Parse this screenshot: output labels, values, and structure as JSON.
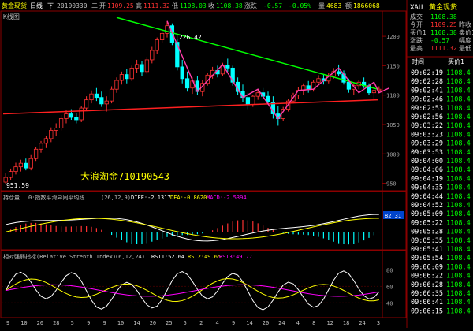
{
  "header": {
    "name": "黄金现货",
    "period": "日线",
    "dir": "下",
    "date": "20100330",
    "weekday": "二",
    "open_label": "开",
    "open": "1109.25",
    "high_label": "高",
    "high": "1111.32",
    "low_label": "低",
    "low": "1108.03",
    "close_label": "收",
    "close": "1108.38",
    "change_label": "涨跌",
    "change": "-0.57",
    "change_pct": "-0.05%",
    "volume_label": "量",
    "volume": "4683",
    "amount_label": "额",
    "amount": "1866068"
  },
  "main_chart": {
    "title": "K线图",
    "peak_label": "1226.42",
    "low_label": "951.59",
    "watermark": "大浪淘金710190543",
    "yticks": [
      "1200",
      "1150",
      "1100",
      "1050",
      "1000",
      "950"
    ]
  },
  "chart_data": [
    {
      "type": "candlestick",
      "title": "K线图",
      "ylim": [
        940,
        1235
      ],
      "annotations": [
        {
          "text": "1226.42",
          "kind": "high"
        },
        {
          "text": "951.59",
          "kind": "low"
        }
      ],
      "trendlines": [
        {
          "color": "#00ff00",
          "from": [
            0.3,
            1232
          ],
          "to": [
            0.99,
            1110
          ]
        },
        {
          "color": "#ff2020",
          "from": [
            0.0,
            1068
          ],
          "to": [
            0.99,
            1092
          ]
        }
      ],
      "candles": [
        [
          952,
          968,
          948,
          960
        ],
        [
          960,
          975,
          955,
          970
        ],
        [
          970,
          985,
          965,
          978
        ],
        [
          978,
          990,
          970,
          984
        ],
        [
          984,
          992,
          972,
          976
        ],
        [
          976,
          998,
          972,
          992
        ],
        [
          992,
          1012,
          988,
          1008
        ],
        [
          1008,
          1022,
          1002,
          1018
        ],
        [
          1018,
          1030,
          1010,
          1026
        ],
        [
          1026,
          1045,
          1020,
          1040
        ],
        [
          1040,
          1052,
          1030,
          1044
        ],
        [
          1044,
          1066,
          1040,
          1060
        ],
        [
          1060,
          1074,
          1052,
          1068
        ],
        [
          1068,
          1076,
          1058,
          1062
        ],
        [
          1062,
          1070,
          1052,
          1058
        ],
        [
          1058,
          1082,
          1054,
          1078
        ],
        [
          1078,
          1098,
          1074,
          1092
        ],
        [
          1092,
          1108,
          1086,
          1102
        ],
        [
          1102,
          1112,
          1090,
          1096
        ],
        [
          1096,
          1106,
          1080,
          1085
        ],
        [
          1085,
          1098,
          1072,
          1090
        ],
        [
          1090,
          1115,
          1086,
          1110
        ],
        [
          1110,
          1130,
          1104,
          1125
        ],
        [
          1125,
          1140,
          1118,
          1135
        ],
        [
          1135,
          1145,
          1120,
          1128
        ],
        [
          1128,
          1150,
          1124,
          1146
        ],
        [
          1146,
          1160,
          1138,
          1152
        ],
        [
          1152,
          1158,
          1132,
          1140
        ],
        [
          1140,
          1165,
          1136,
          1160
        ],
        [
          1160,
          1182,
          1154,
          1176
        ],
        [
          1176,
          1198,
          1170,
          1194
        ],
        [
          1194,
          1212,
          1188,
          1205
        ],
        [
          1205,
          1226,
          1198,
          1218
        ],
        [
          1218,
          1222,
          1185,
          1190
        ],
        [
          1190,
          1196,
          1142,
          1148
        ],
        [
          1148,
          1160,
          1120,
          1128
        ],
        [
          1128,
          1140,
          1106,
          1112
        ],
        [
          1112,
          1130,
          1102,
          1124
        ],
        [
          1124,
          1132,
          1100,
          1106
        ],
        [
          1106,
          1125,
          1098,
          1120
        ],
        [
          1120,
          1138,
          1116,
          1134
        ],
        [
          1134,
          1148,
          1128,
          1142
        ],
        [
          1142,
          1150,
          1130,
          1136
        ],
        [
          1136,
          1155,
          1132,
          1150
        ],
        [
          1150,
          1162,
          1140,
          1146
        ],
        [
          1146,
          1150,
          1116,
          1122
        ],
        [
          1122,
          1130,
          1100,
          1106
        ],
        [
          1106,
          1118,
          1088,
          1096
        ],
        [
          1096,
          1104,
          1076,
          1084
        ],
        [
          1084,
          1100,
          1080,
          1098
        ],
        [
          1098,
          1110,
          1092,
          1104
        ],
        [
          1104,
          1112,
          1094,
          1098
        ],
        [
          1098,
          1106,
          1084,
          1088
        ],
        [
          1088,
          1098,
          1060,
          1068
        ],
        [
          1068,
          1082,
          1048,
          1060
        ],
        [
          1060,
          1080,
          1056,
          1076
        ],
        [
          1076,
          1094,
          1072,
          1090
        ],
        [
          1090,
          1104,
          1086,
          1100
        ],
        [
          1100,
          1114,
          1094,
          1108
        ],
        [
          1108,
          1120,
          1100,
          1116
        ],
        [
          1116,
          1124,
          1104,
          1110
        ],
        [
          1110,
          1126,
          1106,
          1122
        ],
        [
          1122,
          1134,
          1116,
          1128
        ],
        [
          1128,
          1136,
          1118,
          1124
        ],
        [
          1124,
          1138,
          1120,
          1132
        ],
        [
          1132,
          1146,
          1128,
          1140
        ],
        [
          1140,
          1152,
          1132,
          1136
        ],
        [
          1136,
          1142,
          1118,
          1122
        ],
        [
          1122,
          1128,
          1104,
          1110
        ],
        [
          1110,
          1120,
          1100,
          1116
        ],
        [
          1116,
          1126,
          1110,
          1122
        ],
        [
          1122,
          1130,
          1112,
          1116
        ],
        [
          1116,
          1120,
          1100,
          1104
        ],
        [
          1104,
          1112,
          1094,
          1108
        ],
        [
          1108,
          1115,
          1104,
          1110
        ]
      ]
    },
    {
      "type": "line",
      "title": "指数平滑异同平均线",
      "params": "(26,12,9)",
      "DIFF": -2.1317,
      "DEA": -0.862,
      "MACD": -2.5394,
      "right_label": "82.31"
    },
    {
      "type": "line",
      "title": "相对强弱指标(Relative Strenth Index)",
      "params": "(6,12,24)",
      "RSI1": 52.64,
      "RSI2": 49.65,
      "RSI3": 49.77,
      "yticks": [
        "80",
        "60",
        "40"
      ]
    }
  ],
  "subcharts": {
    "macd_label": "持仓量",
    "macd_title": "0:指数平滑异同平均线",
    "macd_params": "(26,12,9)",
    "macd_diff": "DIFF:-2.1317",
    "macd_dea": "DEA:-0.8620",
    "macd_macd": "MACD:-2.5394",
    "macd_right": "82.31",
    "rsi_title": "相对强弱指标(Relative Strenth Index)",
    "rsi_params": "(6,12,24)",
    "rsi1": "RSI1:52.64",
    "rsi2": "RSI2:49.65",
    "rsi3": "RSI3:49.77",
    "rsi_ticks": [
      "80",
      "60",
      "40"
    ]
  },
  "xaxis": {
    "labels": [
      "9",
      "10",
      "20",
      "28",
      "5",
      "9",
      "9",
      "10",
      "14",
      "20",
      "25",
      "5",
      "2",
      "4",
      "9",
      "14",
      "20",
      "24",
      "4",
      "8",
      "12",
      "18",
      "24",
      "3"
    ],
    "page": "1"
  },
  "quote_panel": {
    "code": "XAU",
    "name": "黄金现货",
    "rows": [
      {
        "label": "成交",
        "value": "1108.38",
        "extra": "",
        "color": "#00ff00"
      },
      {
        "label": "今开",
        "value": "1109.25",
        "extra": "昨收",
        "color": "#ff3030"
      },
      {
        "label": "买价1",
        "value": "1108.38",
        "extra": "卖价1",
        "color": "#00ff00"
      },
      {
        "label": "涨跌",
        "value": "-0.57",
        "extra": "幅度",
        "color": "#00ff00"
      },
      {
        "label": "最高",
        "value": "1111.32",
        "extra": "最低",
        "color": "#ff3030"
      }
    ],
    "col_time": "时间",
    "col_price": "买价1",
    "ticks": [
      {
        "time": "09:02:19",
        "price": "1108.4"
      },
      {
        "time": "09:02:28",
        "price": "1108.4"
      },
      {
        "time": "09:02:41",
        "price": "1108.4"
      },
      {
        "time": "09:02:46",
        "price": "1108.4"
      },
      {
        "time": "09:02:53",
        "price": "1108.4"
      },
      {
        "time": "09:02:56",
        "price": "1108.4"
      },
      {
        "time": "09:03:22",
        "price": "1108.4"
      },
      {
        "time": "09:03:23",
        "price": "1108.4"
      },
      {
        "time": "09:03:29",
        "price": "1108.4"
      },
      {
        "time": "09:03:53",
        "price": "1108.4"
      },
      {
        "time": "09:04:00",
        "price": "1108.4"
      },
      {
        "time": "09:04:06",
        "price": "1108.4"
      },
      {
        "time": "09:04:19",
        "price": "1108.4"
      },
      {
        "time": "09:04:35",
        "price": "1108.4"
      },
      {
        "time": "09:04:44",
        "price": "1108.4"
      },
      {
        "time": "09:04:52",
        "price": "1108.4"
      },
      {
        "time": "09:05:09",
        "price": "1108.4"
      },
      {
        "time": "09:05:22",
        "price": "1108.4"
      },
      {
        "time": "09:05:28",
        "price": "1108.4"
      },
      {
        "time": "09:05:35",
        "price": "1108.4"
      },
      {
        "time": "09:05:41",
        "price": "1108.4"
      },
      {
        "time": "09:05:54",
        "price": "1108.4"
      },
      {
        "time": "09:06:09",
        "price": "1108.4"
      },
      {
        "time": "09:06:22",
        "price": "1108.4"
      },
      {
        "time": "09:06:28",
        "price": "1108.4"
      },
      {
        "time": "09:06:35",
        "price": "1108.4"
      },
      {
        "time": "09:06:41",
        "price": "1108.4"
      },
      {
        "time": "09:06:15",
        "price": "1108.4"
      }
    ]
  },
  "colors": {
    "up": "#ff3232",
    "down": "#00ffff",
    "trend_up": "#00ff00",
    "support": "#ff2020",
    "wave": "#ff3caa",
    "grid": "#8b0000",
    "text": "#c0c0c0",
    "yellow": "#ffff00",
    "white": "#ffffff",
    "magenta": "#ff00ff"
  }
}
